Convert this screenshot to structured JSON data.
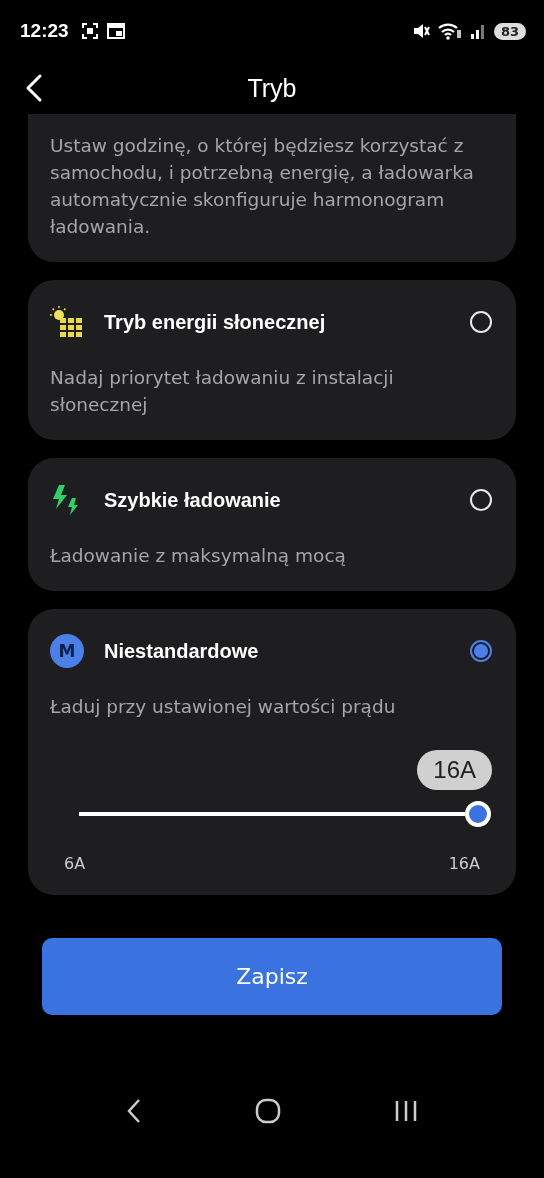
{
  "status_bar": {
    "time": "12:23",
    "battery": "83"
  },
  "header": {
    "title": "Tryb"
  },
  "intro_card": {
    "description": "Ustaw godzinę, o której będziesz korzystać z samochodu, i potrzebną energię, a ładowarka automatycznie skonfiguruje harmonogram ładowania."
  },
  "options": [
    {
      "kind": "solar",
      "title": "Tryb energii słonecznej",
      "description": "Nadaj priorytet ładowaniu z instalacji słonecznej",
      "selected": false
    },
    {
      "kind": "fast",
      "title": "Szybkie ładowanie",
      "description": "Ładowanie z maksymalną mocą",
      "selected": false
    },
    {
      "kind": "custom",
      "icon_letter": "M",
      "title": "Niestandardowe",
      "description": "Ładuj przy ustawionej wartości prądu",
      "selected": true,
      "slider": {
        "level": 1,
        "value_label": "16A",
        "min_label": "6A",
        "max_label": "16A"
      }
    }
  ],
  "save_button": "Zapisz"
}
